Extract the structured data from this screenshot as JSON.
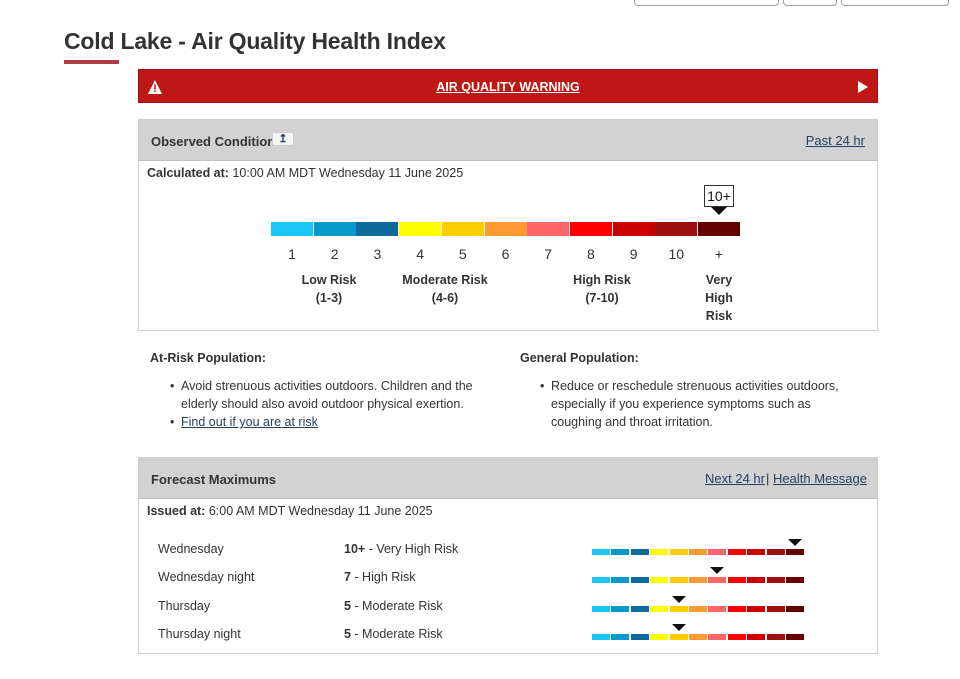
{
  "title": "Cold Lake - Air Quality Health Index",
  "warning": {
    "text": "AIR QUALITY WARNING",
    "icons": [
      "warning-triangle-icon",
      "play-icon"
    ]
  },
  "observed": {
    "title": "Observed Conditions",
    "info_glyph": "↥",
    "link": "Past 24 hr",
    "calculated_label": "Calculated at:",
    "calculated_value": "10:00 AM MDT Wednesday 11 June 2025",
    "current_value": "10+",
    "scale_numbers": [
      "1",
      "2",
      "3",
      "4",
      "5",
      "6",
      "7",
      "8",
      "9",
      "10",
      "+"
    ],
    "scale_colors": [
      "#1ac6f6",
      "#0899cc",
      "#0c6b9b",
      "#ffff00",
      "#ffcc00",
      "#ff9933",
      "#ff6666",
      "#ff0000",
      "#cc0000",
      "#a00f0f",
      "#660000"
    ],
    "risk_labels": [
      {
        "line1": "Low Risk",
        "line2": "(1-3)"
      },
      {
        "line1": "Moderate Risk",
        "line2": "(4-6)"
      },
      {
        "line1": "High Risk",
        "line2": "(7-10)"
      },
      {
        "line1": "Very",
        "line2": "High",
        "line3": "Risk"
      }
    ]
  },
  "at_risk": {
    "heading": "At-Risk Population:",
    "line1": "Avoid strenuous activities outdoors. Children and the",
    "line2": "elderly should also avoid outdoor physical exertion.",
    "link": "Find out if you are at risk"
  },
  "general": {
    "heading": "General Population:",
    "line1": "Reduce or reschedule strenuous activities outdoors,",
    "line2": "especially if you experience symptoms such as",
    "line3": "coughing and throat irritation."
  },
  "forecast": {
    "title": "Forecast Maximums",
    "link1": "Next 24 hr",
    "separator": "|",
    "link2": "Health Message",
    "issued_label": "Issued at:",
    "issued_value": "6:00 AM MDT Wednesday 11 June 2025",
    "rows": [
      {
        "day": "Wednesday",
        "value": "10+",
        "risk": " - Very High Risk",
        "index": 11
      },
      {
        "day": "Wednesday night",
        "value": "7",
        "risk": " - High Risk",
        "index": 7
      },
      {
        "day": "Thursday",
        "value": "5",
        "risk": " - Moderate Risk",
        "index": 5
      },
      {
        "day": "Thursday night",
        "value": "5",
        "risk": " - Moderate Risk",
        "index": 5
      }
    ]
  }
}
